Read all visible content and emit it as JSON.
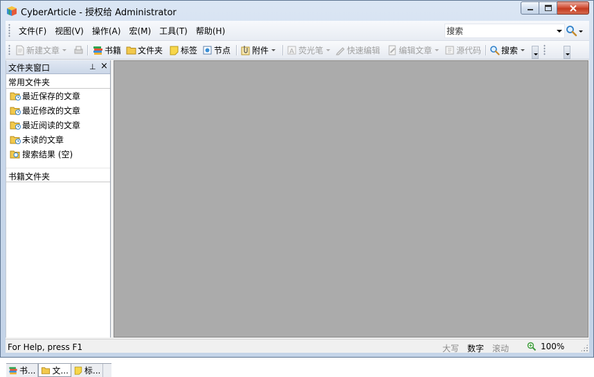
{
  "window": {
    "title": "CyberArticle - 授权给 Administrator"
  },
  "menubar": {
    "items": [
      {
        "label": "文件(F)"
      },
      {
        "label": "视图(V)"
      },
      {
        "label": "操作(A)"
      },
      {
        "label": "宏(M)"
      },
      {
        "label": "工具(T)"
      },
      {
        "label": "帮助(H)"
      }
    ],
    "search": {
      "placeholder": "搜索",
      "value": ""
    }
  },
  "toolbar": {
    "new_article": "新建文章",
    "books": "书籍",
    "folders": "文件夹",
    "tags": "标签",
    "nodes": "节点",
    "attachments": "附件",
    "highlighter": "荧光笔",
    "quick_edit": "快速编辑",
    "edit_article": "编辑文章",
    "source_code": "源代码",
    "search": "搜索"
  },
  "left_panel": {
    "title": "文件夹窗口",
    "pin_icon": "⊥",
    "close_icon": "×",
    "common_group": "常用文件夹",
    "common_items": [
      {
        "label": "最近保存的文章",
        "icon": "recent-saved-folder-icon"
      },
      {
        "label": "最近修改的文章",
        "icon": "recent-modified-folder-icon"
      },
      {
        "label": "最近阅读的文章",
        "icon": "recent-read-folder-icon"
      },
      {
        "label": "未读的文章",
        "icon": "unread-folder-icon"
      },
      {
        "label": "搜索结果 (空)",
        "icon": "search-results-folder-icon"
      }
    ],
    "books_group": "书籍文件夹",
    "tabs": [
      {
        "label": "书...",
        "icon": "books-icon"
      },
      {
        "label": "文...",
        "icon": "folder-icon"
      },
      {
        "label": "标...",
        "icon": "tag-icon"
      }
    ]
  },
  "statusbar": {
    "help_text": "For Help, press F1",
    "caps": "大写",
    "num": "数字",
    "scroll": "滚动",
    "zoom": "100%"
  },
  "colors": {
    "main_area": "#ababab",
    "folder_yellow": "#f2c94c",
    "close_red": "#c43b20"
  }
}
